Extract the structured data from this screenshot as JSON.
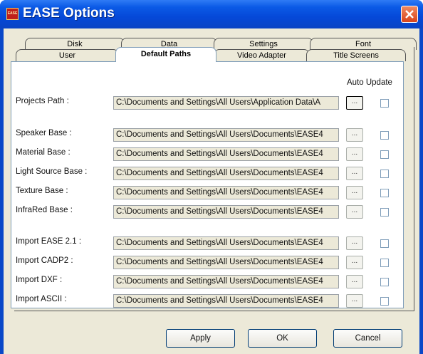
{
  "window": {
    "title": "EASE Options",
    "icon_text": "EASE"
  },
  "tabs_back": [
    "Disk",
    "Data",
    "Settings",
    "Font"
  ],
  "tabs_front": [
    "User",
    "Default Paths",
    "Video Adapter",
    "Title Screens"
  ],
  "active_tab": "Default Paths",
  "auto_update_header": "Auto Update",
  "browse_label": "...",
  "paths": [
    {
      "label": "Projects Path :",
      "value": "C:\\Documents and Settings\\All Users\\Application Data\\A",
      "auto_update": false
    },
    {
      "label": "Speaker Base :",
      "value": "C:\\Documents and Settings\\All Users\\Documents\\EASE4",
      "auto_update": false
    },
    {
      "label": "Material Base :",
      "value": "C:\\Documents and Settings\\All Users\\Documents\\EASE4",
      "auto_update": false
    },
    {
      "label": "Light Source Base :",
      "value": "C:\\Documents and Settings\\All Users\\Documents\\EASE4",
      "auto_update": false
    },
    {
      "label": "Texture Base :",
      "value": "C:\\Documents and Settings\\All Users\\Documents\\EASE4",
      "auto_update": false
    },
    {
      "label": "InfraRed Base :",
      "value": "C:\\Documents and Settings\\All Users\\Documents\\EASE4",
      "auto_update": false
    },
    {
      "label": "Import EASE 2.1 :",
      "value": "C:\\Documents and Settings\\All Users\\Documents\\EASE4",
      "auto_update": false
    },
    {
      "label": "Import CADP2 :",
      "value": "C:\\Documents and Settings\\All Users\\Documents\\EASE4",
      "auto_update": false
    },
    {
      "label": "Import DXF :",
      "value": "C:\\Documents and Settings\\All Users\\Documents\\EASE4",
      "auto_update": false
    },
    {
      "label": "Import ASCII :",
      "value": "C:\\Documents and Settings\\All Users\\Documents\\EASE4",
      "auto_update": false
    }
  ],
  "buttons": {
    "apply": "Apply",
    "ok": "OK",
    "cancel": "Cancel"
  },
  "colors": {
    "titlebar": "#0548d8",
    "close": "#d8431a",
    "face": "#ece9d8"
  }
}
